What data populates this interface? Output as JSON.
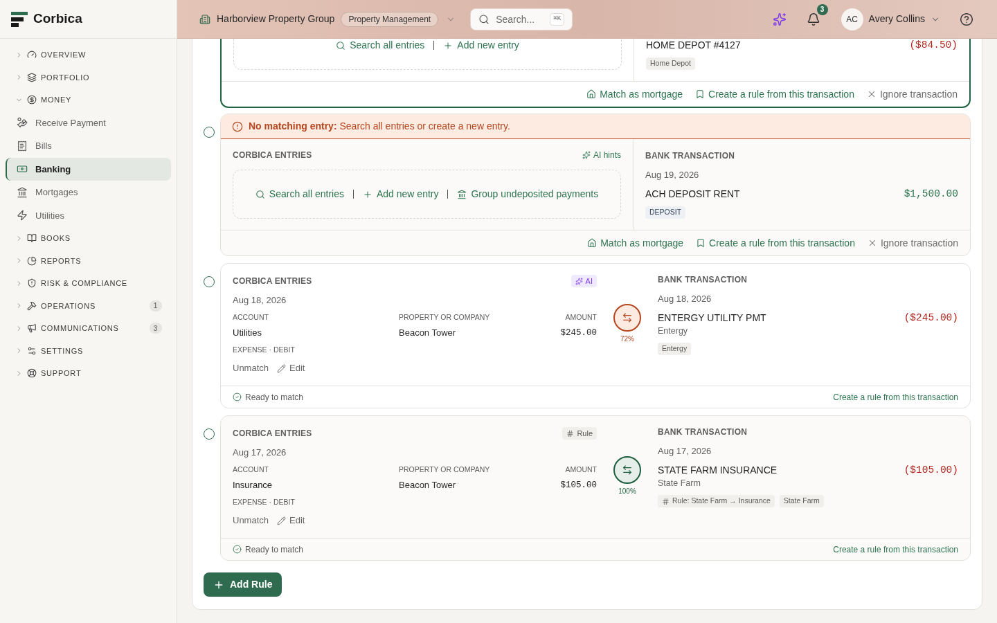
{
  "sidebar": {
    "brand": "Corbica",
    "items": [
      {
        "label": "OVERVIEW",
        "expanded": false
      },
      {
        "label": "PORTFOLIO",
        "expanded": false
      },
      {
        "label": "MONEY",
        "expanded": true,
        "children": [
          {
            "label": "Receive Payment",
            "selected": false
          },
          {
            "label": "Bills",
            "selected": false
          },
          {
            "label": "Banking",
            "selected": true
          },
          {
            "label": "Mortgages",
            "selected": false
          },
          {
            "label": "Utilities",
            "selected": false
          }
        ]
      },
      {
        "label": "BOOKS",
        "expanded": false
      },
      {
        "label": "REPORTS",
        "expanded": false
      },
      {
        "label": "RISK & COMPLIANCE",
        "expanded": false
      },
      {
        "label": "OPERATIONS",
        "expanded": false,
        "badge": "1"
      },
      {
        "label": "COMMUNICATIONS",
        "expanded": false,
        "badge": "3"
      },
      {
        "label": "SETTINGS",
        "expanded": false
      },
      {
        "label": "SUPPORT",
        "expanded": false
      }
    ]
  },
  "header": {
    "organization": "Harborview Property Group",
    "organization_type": "Property Management",
    "search": {
      "placeholder": "Search...",
      "shortcut": "⌘K"
    },
    "notification_count": "3",
    "user": {
      "initials": "AC",
      "name": "Avery Collins"
    }
  },
  "transactions": [
    {
      "kind": "unmatched",
      "selected": true,
      "entry_actions": [
        {
          "kind": "search",
          "label": "Search all entries"
        },
        {
          "kind": "add",
          "label": "Add new entry"
        }
      ],
      "bank": {
        "name": "HOME DEPOT #4127",
        "amount": {
          "text": "($84.50)",
          "kind": "debit"
        },
        "tags": [
          {
            "kind": "vendor",
            "label": "Home Depot"
          }
        ]
      },
      "actions": [
        {
          "kind": "mortgage",
          "label": "Match as mortgage"
        },
        {
          "kind": "rule",
          "label": "Create a rule from this transaction"
        },
        {
          "kind": "ignore",
          "label": "Ignore transaction"
        }
      ]
    },
    {
      "kind": "unmatched",
      "selected": false,
      "checked": false,
      "alert": {
        "title": "No matching entry:",
        "message": "Search all entries or create a new entry."
      },
      "entries": {
        "heading": "CORBICA ENTRIES",
        "hint": "AI hints"
      },
      "entry_actions": [
        {
          "kind": "search",
          "label": "Search all entries"
        },
        {
          "kind": "add",
          "label": "Add new entry"
        },
        {
          "kind": "group",
          "label": "Group undeposited payments"
        }
      ],
      "bank": {
        "heading": "BANK TRANSACTION",
        "date": "Aug 19, 2026",
        "name": "ACH DEPOSIT RENT",
        "amount": {
          "text": "$1,500.00",
          "kind": "credit"
        },
        "tags": [
          {
            "kind": "category",
            "label": "DEPOSIT"
          }
        ]
      },
      "actions": [
        {
          "kind": "mortgage",
          "label": "Match as mortgage"
        },
        {
          "kind": "rule",
          "label": "Create a rule from this transaction"
        },
        {
          "kind": "ignore",
          "label": "Ignore transaction"
        }
      ]
    },
    {
      "kind": "matched",
      "selected": false,
      "checked": false,
      "entries": {
        "heading": "CORBICA ENTRIES",
        "source": {
          "kind": "ai",
          "label": "AI"
        },
        "date": "Aug 18, 2026",
        "fields": [
          {
            "label": "ACCOUNT",
            "value": "Utilities"
          },
          {
            "label": "PROPERTY OR COMPANY",
            "value": "Beacon Tower"
          },
          {
            "label": "AMOUNT",
            "value": "$245.00"
          }
        ],
        "type": "EXPENSE · DEBIT",
        "actions": [
          {
            "kind": "unmatch",
            "label": "Unmatch"
          },
          {
            "kind": "edit",
            "label": "Edit"
          }
        ]
      },
      "match": {
        "kind": "partial",
        "score": "72%"
      },
      "bank": {
        "heading": "BANK TRANSACTION",
        "date": "Aug 18, 2026",
        "name": "ENTERGY UTILITY PMT",
        "payee": "Entergy",
        "amount": {
          "text": "($245.00)",
          "kind": "debit"
        },
        "tags": [
          {
            "kind": "vendor",
            "label": "Entergy"
          }
        ]
      },
      "status": "Ready to match",
      "footer_action": "Create a rule from this transaction"
    },
    {
      "kind": "matched",
      "selected": false,
      "checked": false,
      "entries": {
        "heading": "CORBICA ENTRIES",
        "source": {
          "kind": "rule",
          "label": "Rule"
        },
        "date": "Aug 17, 2026",
        "fields": [
          {
            "label": "ACCOUNT",
            "value": "Insurance"
          },
          {
            "label": "PROPERTY OR COMPANY",
            "value": "Beacon Tower"
          },
          {
            "label": "AMOUNT",
            "value": "$105.00"
          }
        ],
        "type": "EXPENSE · DEBIT",
        "actions": [
          {
            "kind": "unmatch",
            "label": "Unmatch"
          },
          {
            "kind": "edit",
            "label": "Edit"
          }
        ]
      },
      "match": {
        "kind": "exact",
        "score": "100%"
      },
      "bank": {
        "heading": "BANK TRANSACTION",
        "date": "Aug 17, 2026",
        "name": "STATE FARM INSURANCE",
        "payee": "State Farm",
        "amount": {
          "text": "($105.00)",
          "kind": "debit"
        },
        "tags": [
          {
            "kind": "rule",
            "label": "Rule: State Farm → Insurance"
          },
          {
            "kind": "vendor",
            "label": "State Farm"
          }
        ]
      },
      "status": "Ready to match",
      "footer_action": "Create a rule from this transaction"
    }
  ],
  "add_rule_button": "Add Rule"
}
